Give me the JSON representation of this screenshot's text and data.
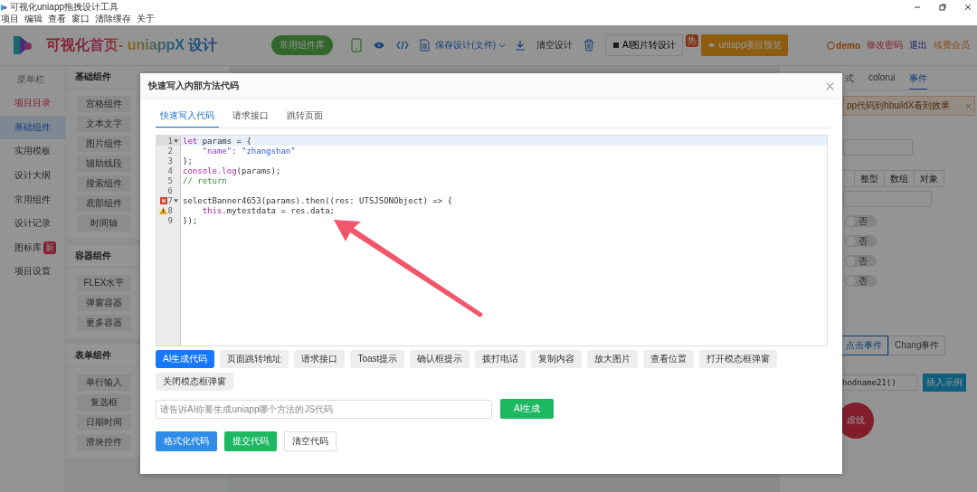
{
  "window": {
    "title": "可视化uniapp拖拽设计工具"
  },
  "menu": [
    "项目",
    "编辑",
    "查看",
    "窗口",
    "清除缓存",
    "关于"
  ],
  "header": {
    "logo": "可视化首页- uniappX 设计",
    "library_button": "常用组件库",
    "save_label": "保存设计(文件)",
    "clear_label": "清空设计",
    "ai_button": "AI图片转设计",
    "hot_badge": "热",
    "preview_button": "uniapp项目预览",
    "user": "demo",
    "change_password": "修改密码",
    "logout": "退出",
    "renew": "续费会员"
  },
  "sidebar": {
    "heading": "菜单栏",
    "items": [
      {
        "label": "项目目录",
        "selected": false,
        "accent": true
      },
      {
        "label": "基础组件",
        "selected": true,
        "accent": false
      },
      {
        "label": "实用模板",
        "selected": false,
        "accent": false
      },
      {
        "label": "设计大纲",
        "selected": false,
        "accent": false
      },
      {
        "label": "常用组件",
        "selected": false,
        "accent": false
      },
      {
        "label": "设计记录",
        "selected": false,
        "accent": false
      },
      {
        "label": "图标库",
        "selected": false,
        "accent": false,
        "badge": "新"
      },
      {
        "label": "项目设置",
        "selected": false,
        "accent": false
      }
    ]
  },
  "components": [
    {
      "title": "基础组件",
      "items": [
        "宫格组件",
        "文本文字",
        "图片组件",
        "辅助线段",
        "搜索组件",
        "底部组件",
        "时间轴"
      ]
    },
    {
      "title": "容器组件",
      "items": [
        "FLEX水平",
        "弹窗容器",
        "更多容器"
      ]
    },
    {
      "title": "表单组件",
      "items": [
        "单行输入",
        "复选框",
        "日期时间",
        "滑块控件"
      ]
    }
  ],
  "right_panel": {
    "tabs": [
      {
        "label": "式",
        "selected": false
      },
      {
        "label": "colorui",
        "selected": false
      },
      {
        "label": "事件",
        "selected": true
      }
    ],
    "notice": "pp代码到hbuildX看到效果",
    "segments": [
      "整型",
      "数组",
      "对象"
    ],
    "toggles": [
      {
        "label": "否",
        "on": false
      },
      {
        "label": "否",
        "on": false
      },
      {
        "label": "否",
        "on": false
      },
      {
        "label": "否",
        "on": false
      }
    ],
    "event_buttons": [
      {
        "label": "点击事件",
        "selected": true
      },
      {
        "label": "Chang事件",
        "selected": false
      }
    ],
    "method_value": "hodname21()",
    "insert_button": "插入示例",
    "fab": "虚线"
  },
  "modal": {
    "title": "快速写入内部方法代码",
    "tabs": [
      {
        "label": "快速写入代码",
        "selected": true
      },
      {
        "label": "请求接口",
        "selected": false
      },
      {
        "label": "跳转页面",
        "selected": false
      }
    ],
    "code_lines": [
      {
        "number": "1",
        "error": false,
        "warning": false,
        "fold": true,
        "tokens": [
          {
            "text": "let",
            "kind": "keyword"
          },
          {
            "text": " params = {",
            "kind": "plain"
          }
        ]
      },
      {
        "number": "2",
        "error": false,
        "warning": false,
        "fold": false,
        "tokens": [
          {
            "text": "    \"name\"",
            "kind": "key"
          },
          {
            "text": ": ",
            "kind": "plain"
          },
          {
            "text": "\"zhangshan\"",
            "kind": "string"
          }
        ]
      },
      {
        "number": "3",
        "error": false,
        "warning": false,
        "fold": false,
        "tokens": [
          {
            "text": "};",
            "kind": "plain"
          }
        ]
      },
      {
        "number": "4",
        "error": false,
        "warning": false,
        "fold": false,
        "tokens": [
          {
            "text": "console.log",
            "kind": "keyword"
          },
          {
            "text": "(params);",
            "kind": "plain"
          }
        ]
      },
      {
        "number": "5",
        "error": false,
        "warning": false,
        "fold": false,
        "tokens": [
          {
            "text": "// return",
            "kind": "comment"
          }
        ]
      },
      {
        "number": "6",
        "error": false,
        "warning": false,
        "fold": false
      },
      {
        "number": "7",
        "error": true,
        "warning": false,
        "fold": true,
        "tokens": [
          {
            "text": "selectBanner4653(params).then((res: UTSJSONObject) => {",
            "kind": "plain"
          }
        ]
      },
      {
        "number": "8",
        "error": false,
        "warning": true,
        "fold": false,
        "tokens": [
          {
            "text": "    this",
            "kind": "keyword"
          },
          {
            "text": ".mytestdata = res.data;",
            "kind": "plain"
          }
        ]
      },
      {
        "number": "9",
        "error": false,
        "warning": false,
        "fold": false,
        "tokens": [
          {
            "text": "});",
            "kind": "plain"
          }
        ]
      }
    ],
    "snippets": [
      {
        "label": "AI生成代码",
        "kind": "primary"
      },
      {
        "label": "页面跳转地址",
        "kind": "default"
      },
      {
        "label": "请求接口",
        "kind": "default"
      },
      {
        "label": "Toast提示",
        "kind": "default"
      },
      {
        "label": "确认框提示",
        "kind": "default"
      },
      {
        "label": "拨打电话",
        "kind": "default"
      },
      {
        "label": "复制内容",
        "kind": "default"
      },
      {
        "label": "放大图片",
        "kind": "default"
      },
      {
        "label": "查看位置",
        "kind": "default"
      },
      {
        "label": "打开模态框弹窗",
        "kind": "default"
      },
      {
        "label": "关闭模态框弹窗",
        "kind": "default"
      }
    ],
    "ai_placeholder": "请告诉AI你要生成uniapp哪个方法的JS代码",
    "ai_button": "AI生成",
    "actions": [
      {
        "label": "格式化代码",
        "kind": "primary"
      },
      {
        "label": "提交代码",
        "kind": "success"
      },
      {
        "label": "清空代码",
        "kind": "default"
      }
    ]
  }
}
